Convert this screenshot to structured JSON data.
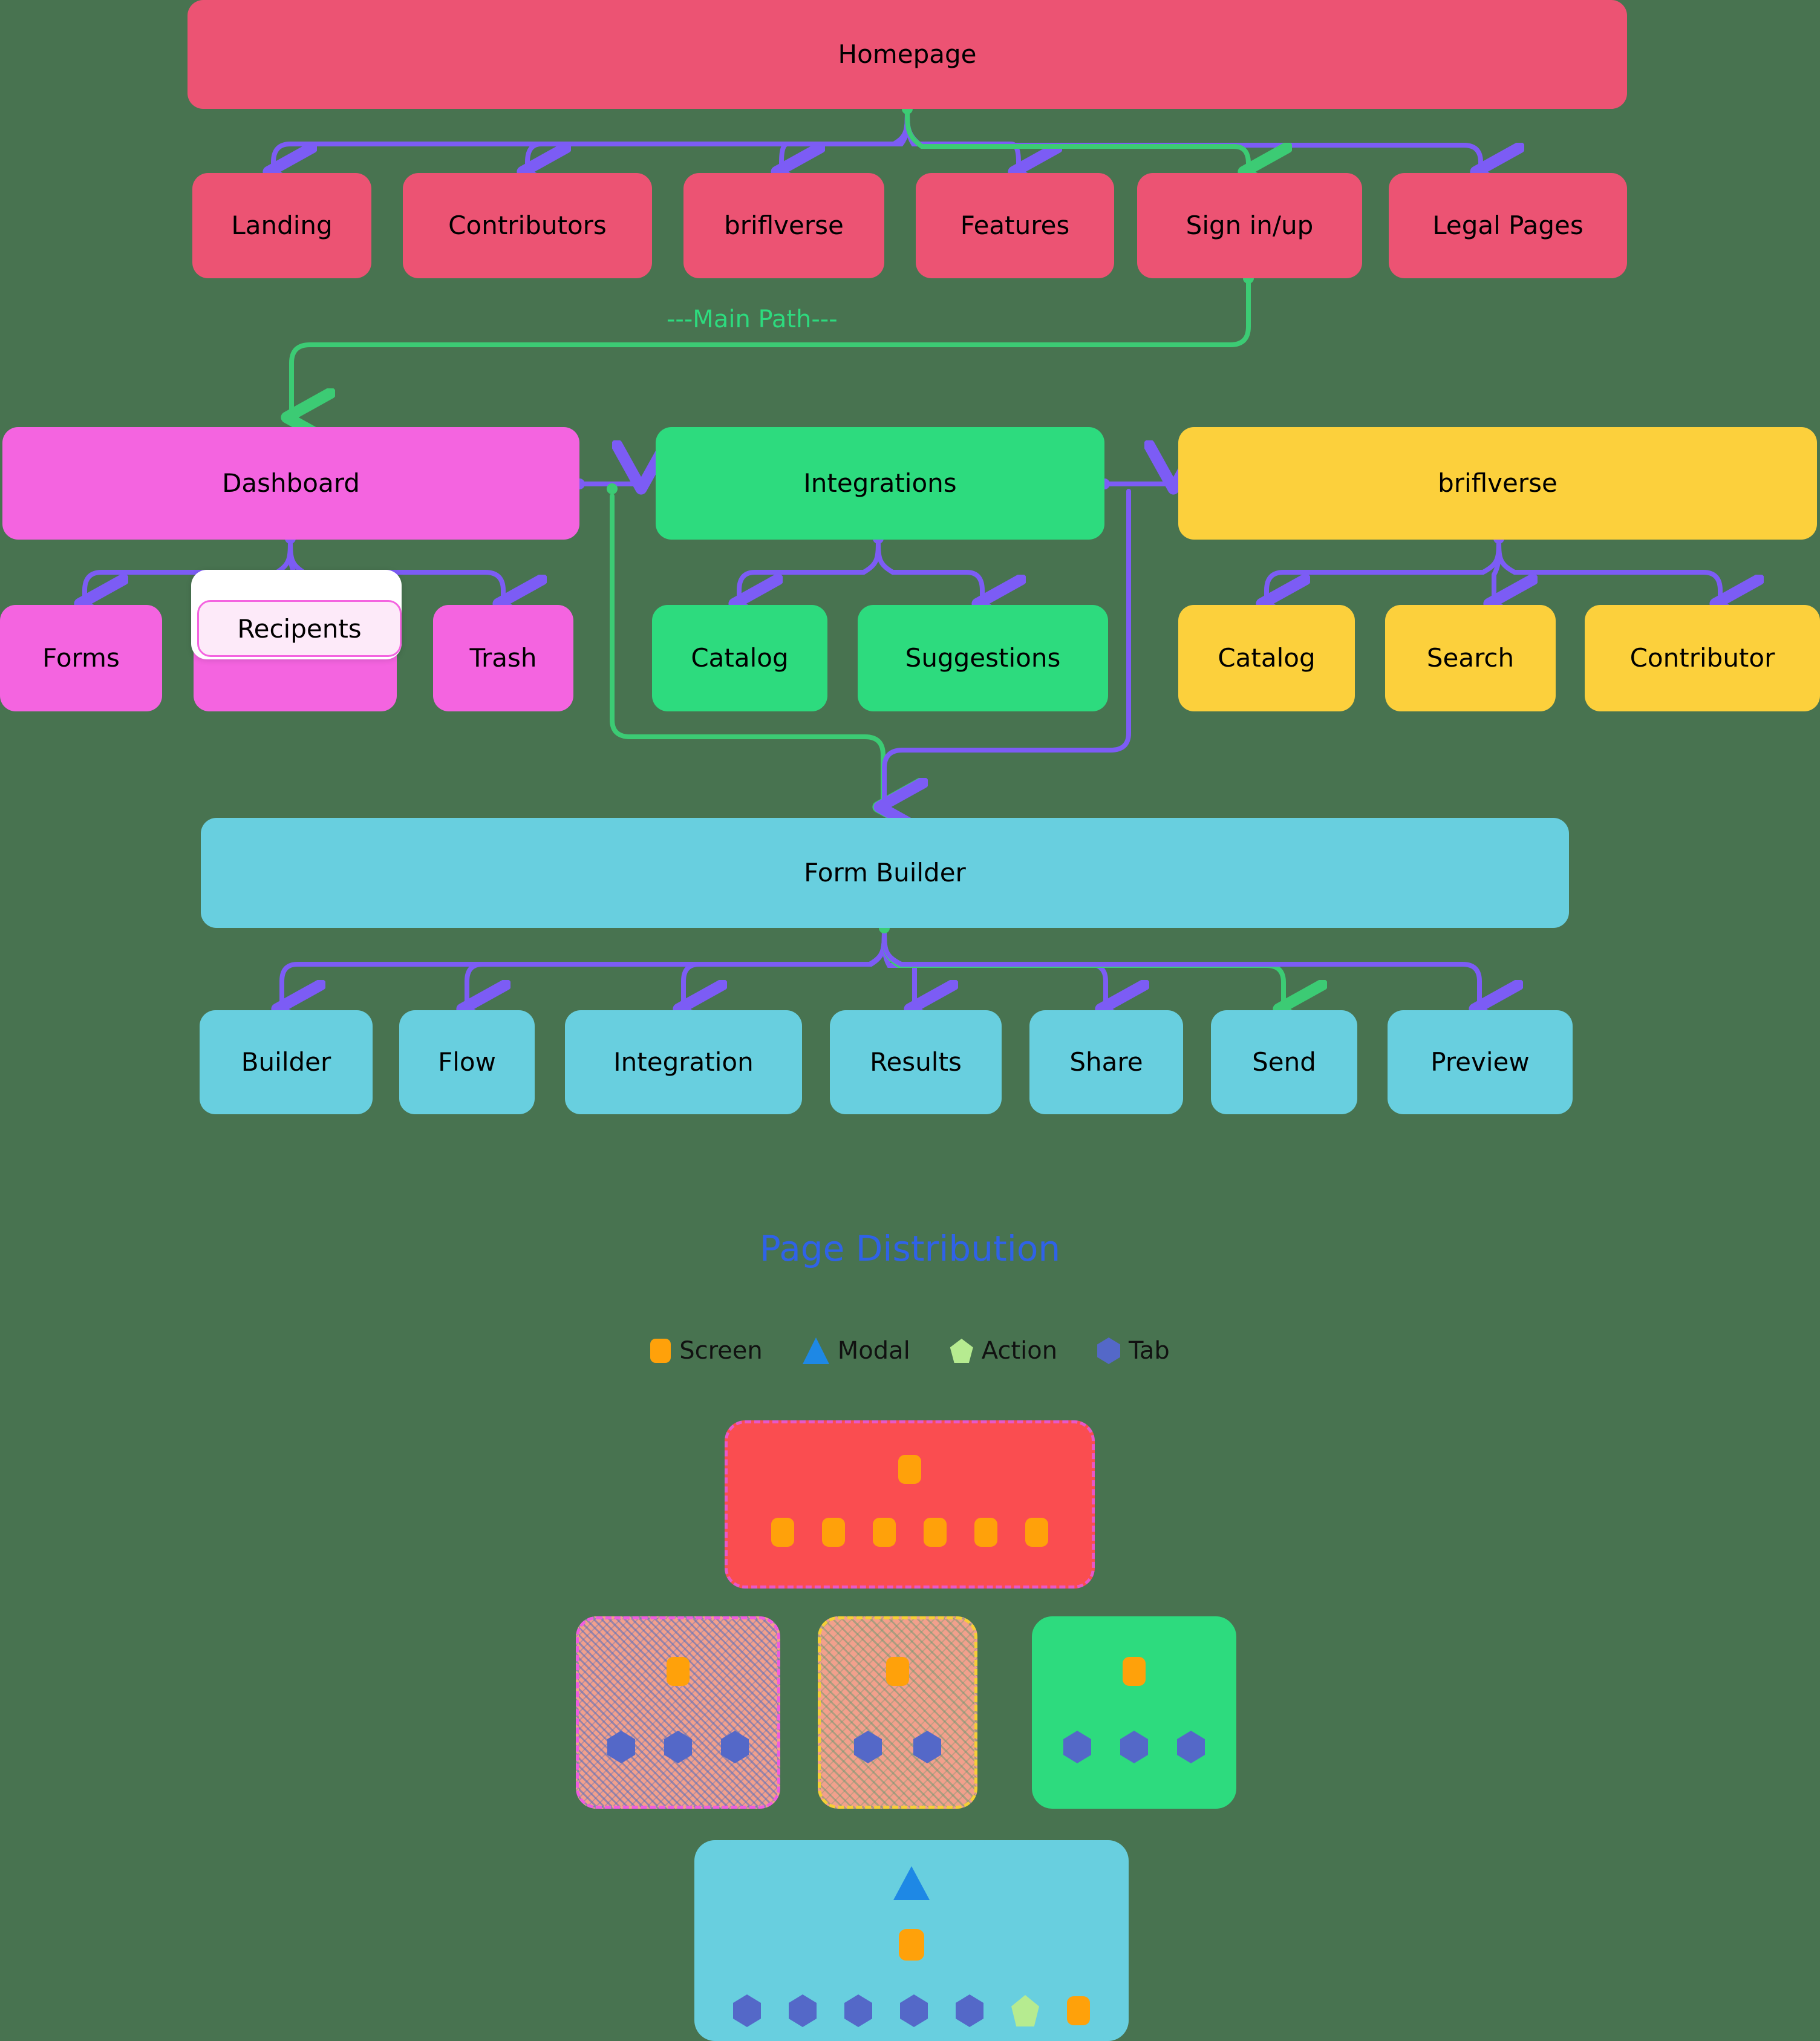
{
  "diagram": {
    "main_path_label": "---Main Path---",
    "nodes": {
      "homepage": "Homepage",
      "landing": "Landing",
      "contributors": "Contributors",
      "briflverse_top": "briflverse",
      "features": "Features",
      "signinup": "Sign in/up",
      "legal_pages": "Legal Pages",
      "dashboard": "Dashboard",
      "integrations": "Integrations",
      "briflverse": "briflverse",
      "forms": "Forms",
      "recipents": "Recipents",
      "trash": "Trash",
      "int_catalog": "Catalog",
      "int_suggestions": "Suggestions",
      "bv_catalog": "Catalog",
      "bv_search": "Search",
      "bv_contributor": "Contributor",
      "form_builder": "Form Builder",
      "fb_builder": "Builder",
      "fb_flow": "Flow",
      "fb_integration": "Integration",
      "fb_results": "Results",
      "fb_share": "Share",
      "fb_send": "Send",
      "fb_preview": "Preview"
    },
    "colors": {
      "background": "#487350",
      "red": "#ec5373",
      "pink": "#f464e0",
      "green": "#2ddb7e",
      "yellow": "#fcd03c",
      "cyan": "#68cfdf",
      "edge_purple": "#7c5cf5",
      "edge_green": "#3ccb74"
    }
  },
  "distribution": {
    "title": "Page Distribution",
    "legend": [
      {
        "label": "Screen",
        "shape": "square",
        "color": "#ffa10a"
      },
      {
        "label": "Modal",
        "shape": "triangle",
        "color": "#1e88e5"
      },
      {
        "label": "Action",
        "shape": "pentagon",
        "color": "#b6eb90"
      },
      {
        "label": "Tab",
        "shape": "hexagon",
        "color": "#5468c8"
      }
    ],
    "cards": [
      {
        "name": "homepage-group",
        "fill": "#fa4d50",
        "border": "#e857c8",
        "border_style": "dashed",
        "rows": [
          {
            "glyphs": [
              "screen"
            ]
          },
          {
            "glyphs": [
              "screen",
              "screen",
              "screen",
              "screen",
              "screen",
              "screen"
            ]
          }
        ]
      },
      {
        "name": "dashboard-group",
        "fill": "#f2a08c",
        "border": "#ef5ce0",
        "border_style": "dashed",
        "rows": [
          {
            "glyphs": [
              "screen"
            ]
          },
          {
            "glyphs": [
              "tab",
              "tab",
              "tab"
            ]
          }
        ]
      },
      {
        "name": "briflverse-group",
        "fill": "#f2a08c",
        "border": "#f6cf36",
        "border_style": "dashed",
        "rows": [
          {
            "glyphs": [
              "screen"
            ]
          },
          {
            "glyphs": [
              "tab",
              "tab"
            ]
          }
        ]
      },
      {
        "name": "integrations-group",
        "fill": "#2ddb7e",
        "border": "#2ddb7e",
        "border_style": "solid",
        "rows": [
          {
            "glyphs": [
              "screen"
            ]
          },
          {
            "glyphs": [
              "tab",
              "tab",
              "tab"
            ]
          }
        ]
      },
      {
        "name": "form-builder-group",
        "fill": "#68cfdf",
        "border": "#68cfdf",
        "border_style": "dashed",
        "rows": [
          {
            "glyphs": [
              "modal"
            ]
          },
          {
            "glyphs": [
              "screen"
            ]
          },
          {
            "glyphs": [
              "tab",
              "tab",
              "tab",
              "tab",
              "tab",
              "action",
              "screen"
            ]
          }
        ]
      }
    ]
  },
  "chart_data": {
    "type": "bar",
    "title": "Page Distribution",
    "categories": [
      "Homepage",
      "Dashboard",
      "briflverse",
      "Integrations",
      "Form Builder"
    ],
    "series": [
      {
        "name": "Screen",
        "values": [
          7,
          1,
          1,
          1,
          2
        ]
      },
      {
        "name": "Tab",
        "values": [
          0,
          3,
          2,
          3,
          5
        ]
      },
      {
        "name": "Action",
        "values": [
          0,
          0,
          0,
          0,
          1
        ]
      },
      {
        "name": "Modal",
        "values": [
          0,
          0,
          0,
          0,
          1
        ]
      }
    ],
    "legend": [
      "Screen",
      "Modal",
      "Action",
      "Tab"
    ],
    "xlabel": "",
    "ylabel": "",
    "grid": false
  }
}
